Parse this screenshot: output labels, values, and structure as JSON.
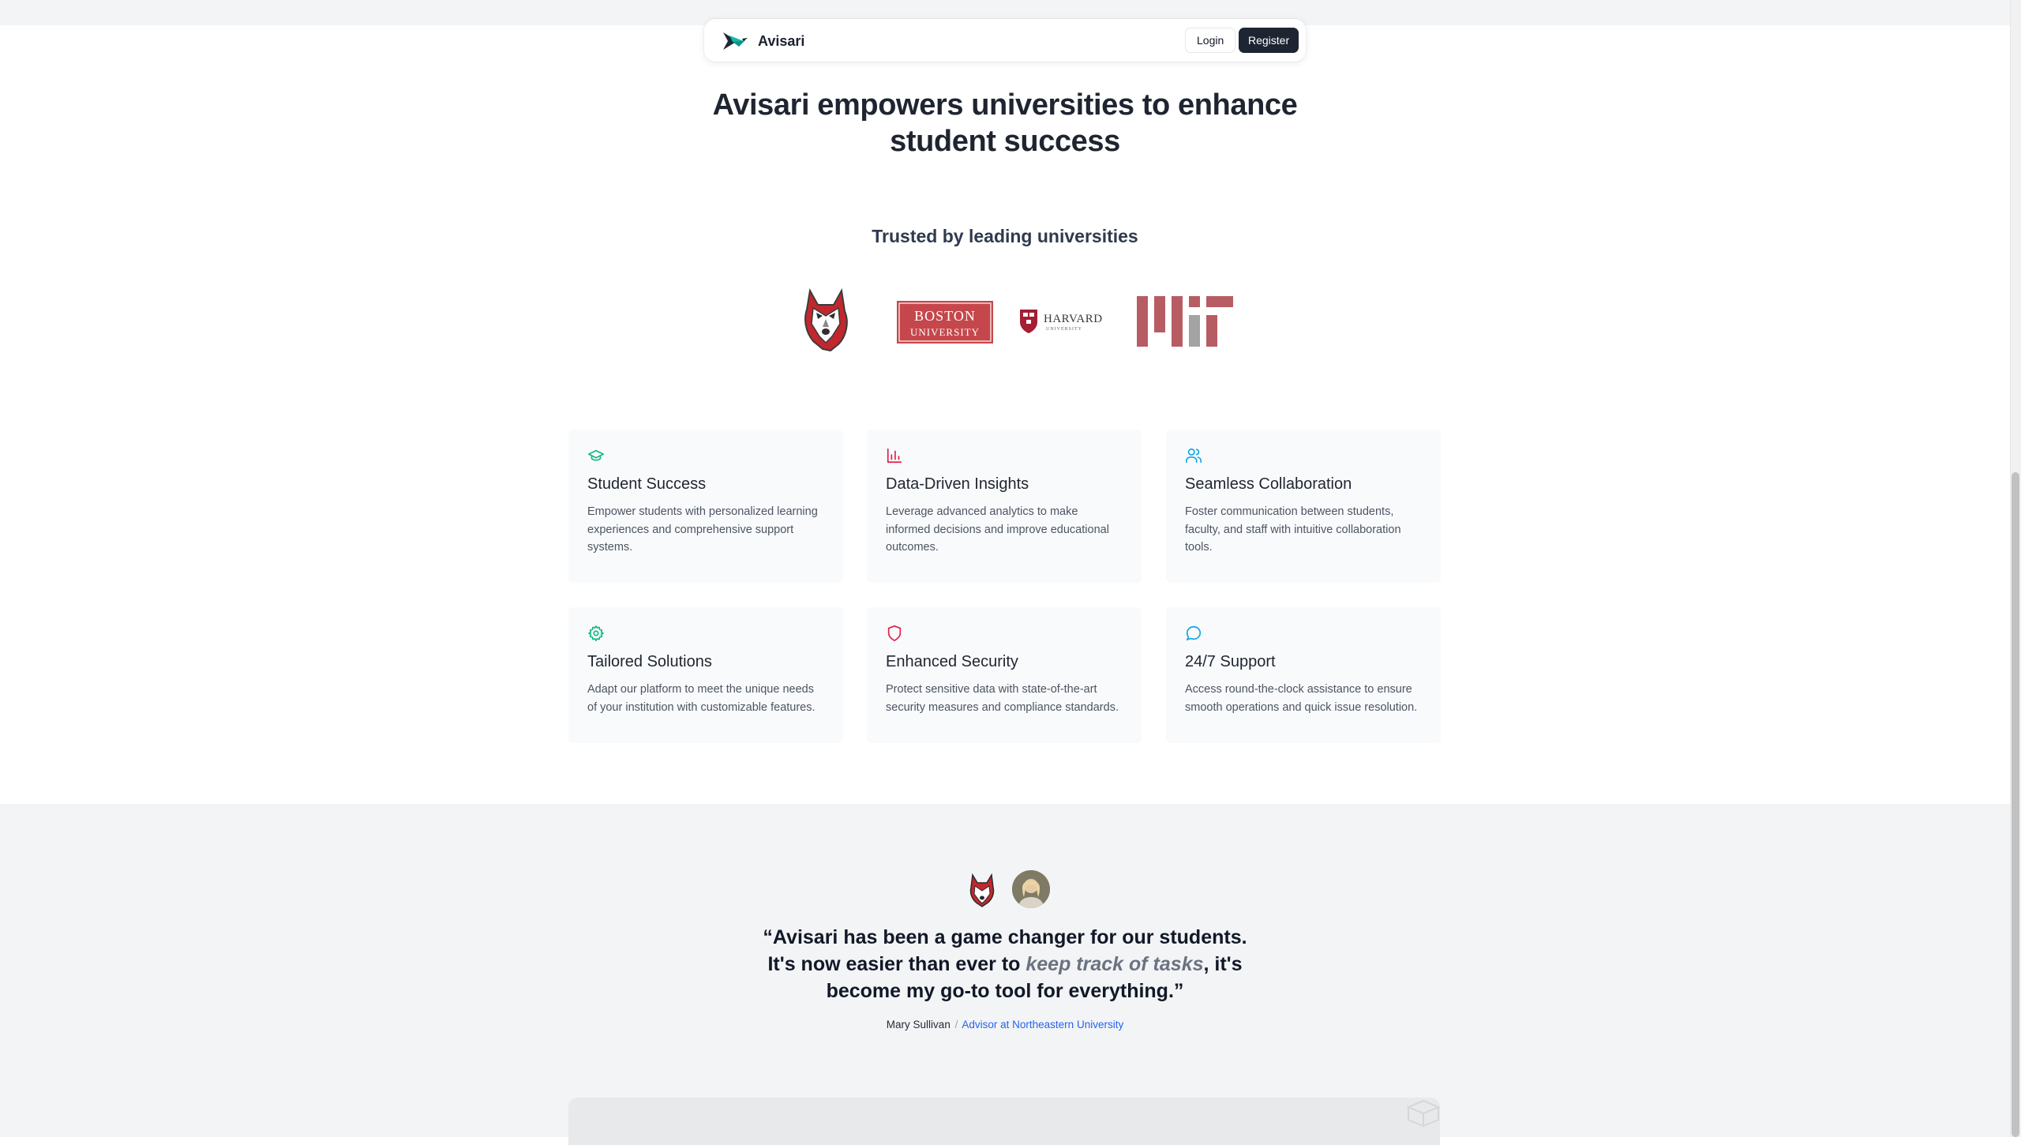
{
  "nav": {
    "brand": "Avisari",
    "login": "Login",
    "register": "Register"
  },
  "hero": {
    "title_line1": "Avisari empowers universities to enhance",
    "title_line2": "student success"
  },
  "trusted": {
    "heading": "Trusted by leading universities",
    "logos": [
      {
        "name": "husky",
        "icon": "husky-logo"
      },
      {
        "name": "boston",
        "line1": "BOSTON",
        "line2": "UNIVERSITY"
      },
      {
        "name": "harvard",
        "line1": "HARVARD",
        "line2": "UNIVERSITY"
      },
      {
        "name": "mit",
        "icon": "mit-logo"
      }
    ]
  },
  "features": [
    {
      "icon": "graduation-cap-icon",
      "color": "#10b981",
      "title": "Student Success",
      "desc": "Empower students with personalized learning experiences and comprehensive support systems."
    },
    {
      "icon": "bar-chart-icon",
      "color": "#e11d48",
      "title": "Data-Driven Insights",
      "desc": "Leverage advanced analytics to make informed decisions and improve educational outcomes."
    },
    {
      "icon": "users-icon",
      "color": "#0ea5e9",
      "title": "Seamless Collaboration",
      "desc": "Foster communication between students, faculty, and staff with intuitive collaboration tools."
    },
    {
      "icon": "settings-gear-icon",
      "color": "#10b981",
      "title": "Tailored Solutions",
      "desc": "Adapt our platform to meet the unique needs of your institution with customizable features."
    },
    {
      "icon": "shield-icon",
      "color": "#e11d48",
      "title": "Enhanced Security",
      "desc": "Protect sensitive data with state-of-the-art security measures and compliance standards."
    },
    {
      "icon": "message-circle-icon",
      "color": "#0ea5e9",
      "title": "24/7 Support",
      "desc": "Access round-the-clock assistance to ensure smooth operations and quick issue resolution."
    }
  ],
  "testimonial": {
    "quote_open": "“Avisari has been a game changer for our students. It's now easier than ever to ",
    "quote_highlight": "keep track of tasks",
    "quote_close": ", it's become my go-to tool for everything.”",
    "author": "Mary Sullivan",
    "separator": "/",
    "role": "Advisor at Northeastern University"
  },
  "colors": {
    "dark_button": "#1e2532",
    "green_accent": "#10b981",
    "red_accent": "#e11d48",
    "blue_accent": "#0ea5e9",
    "link_blue": "#2563eb",
    "logo_red": "#b85c63"
  }
}
